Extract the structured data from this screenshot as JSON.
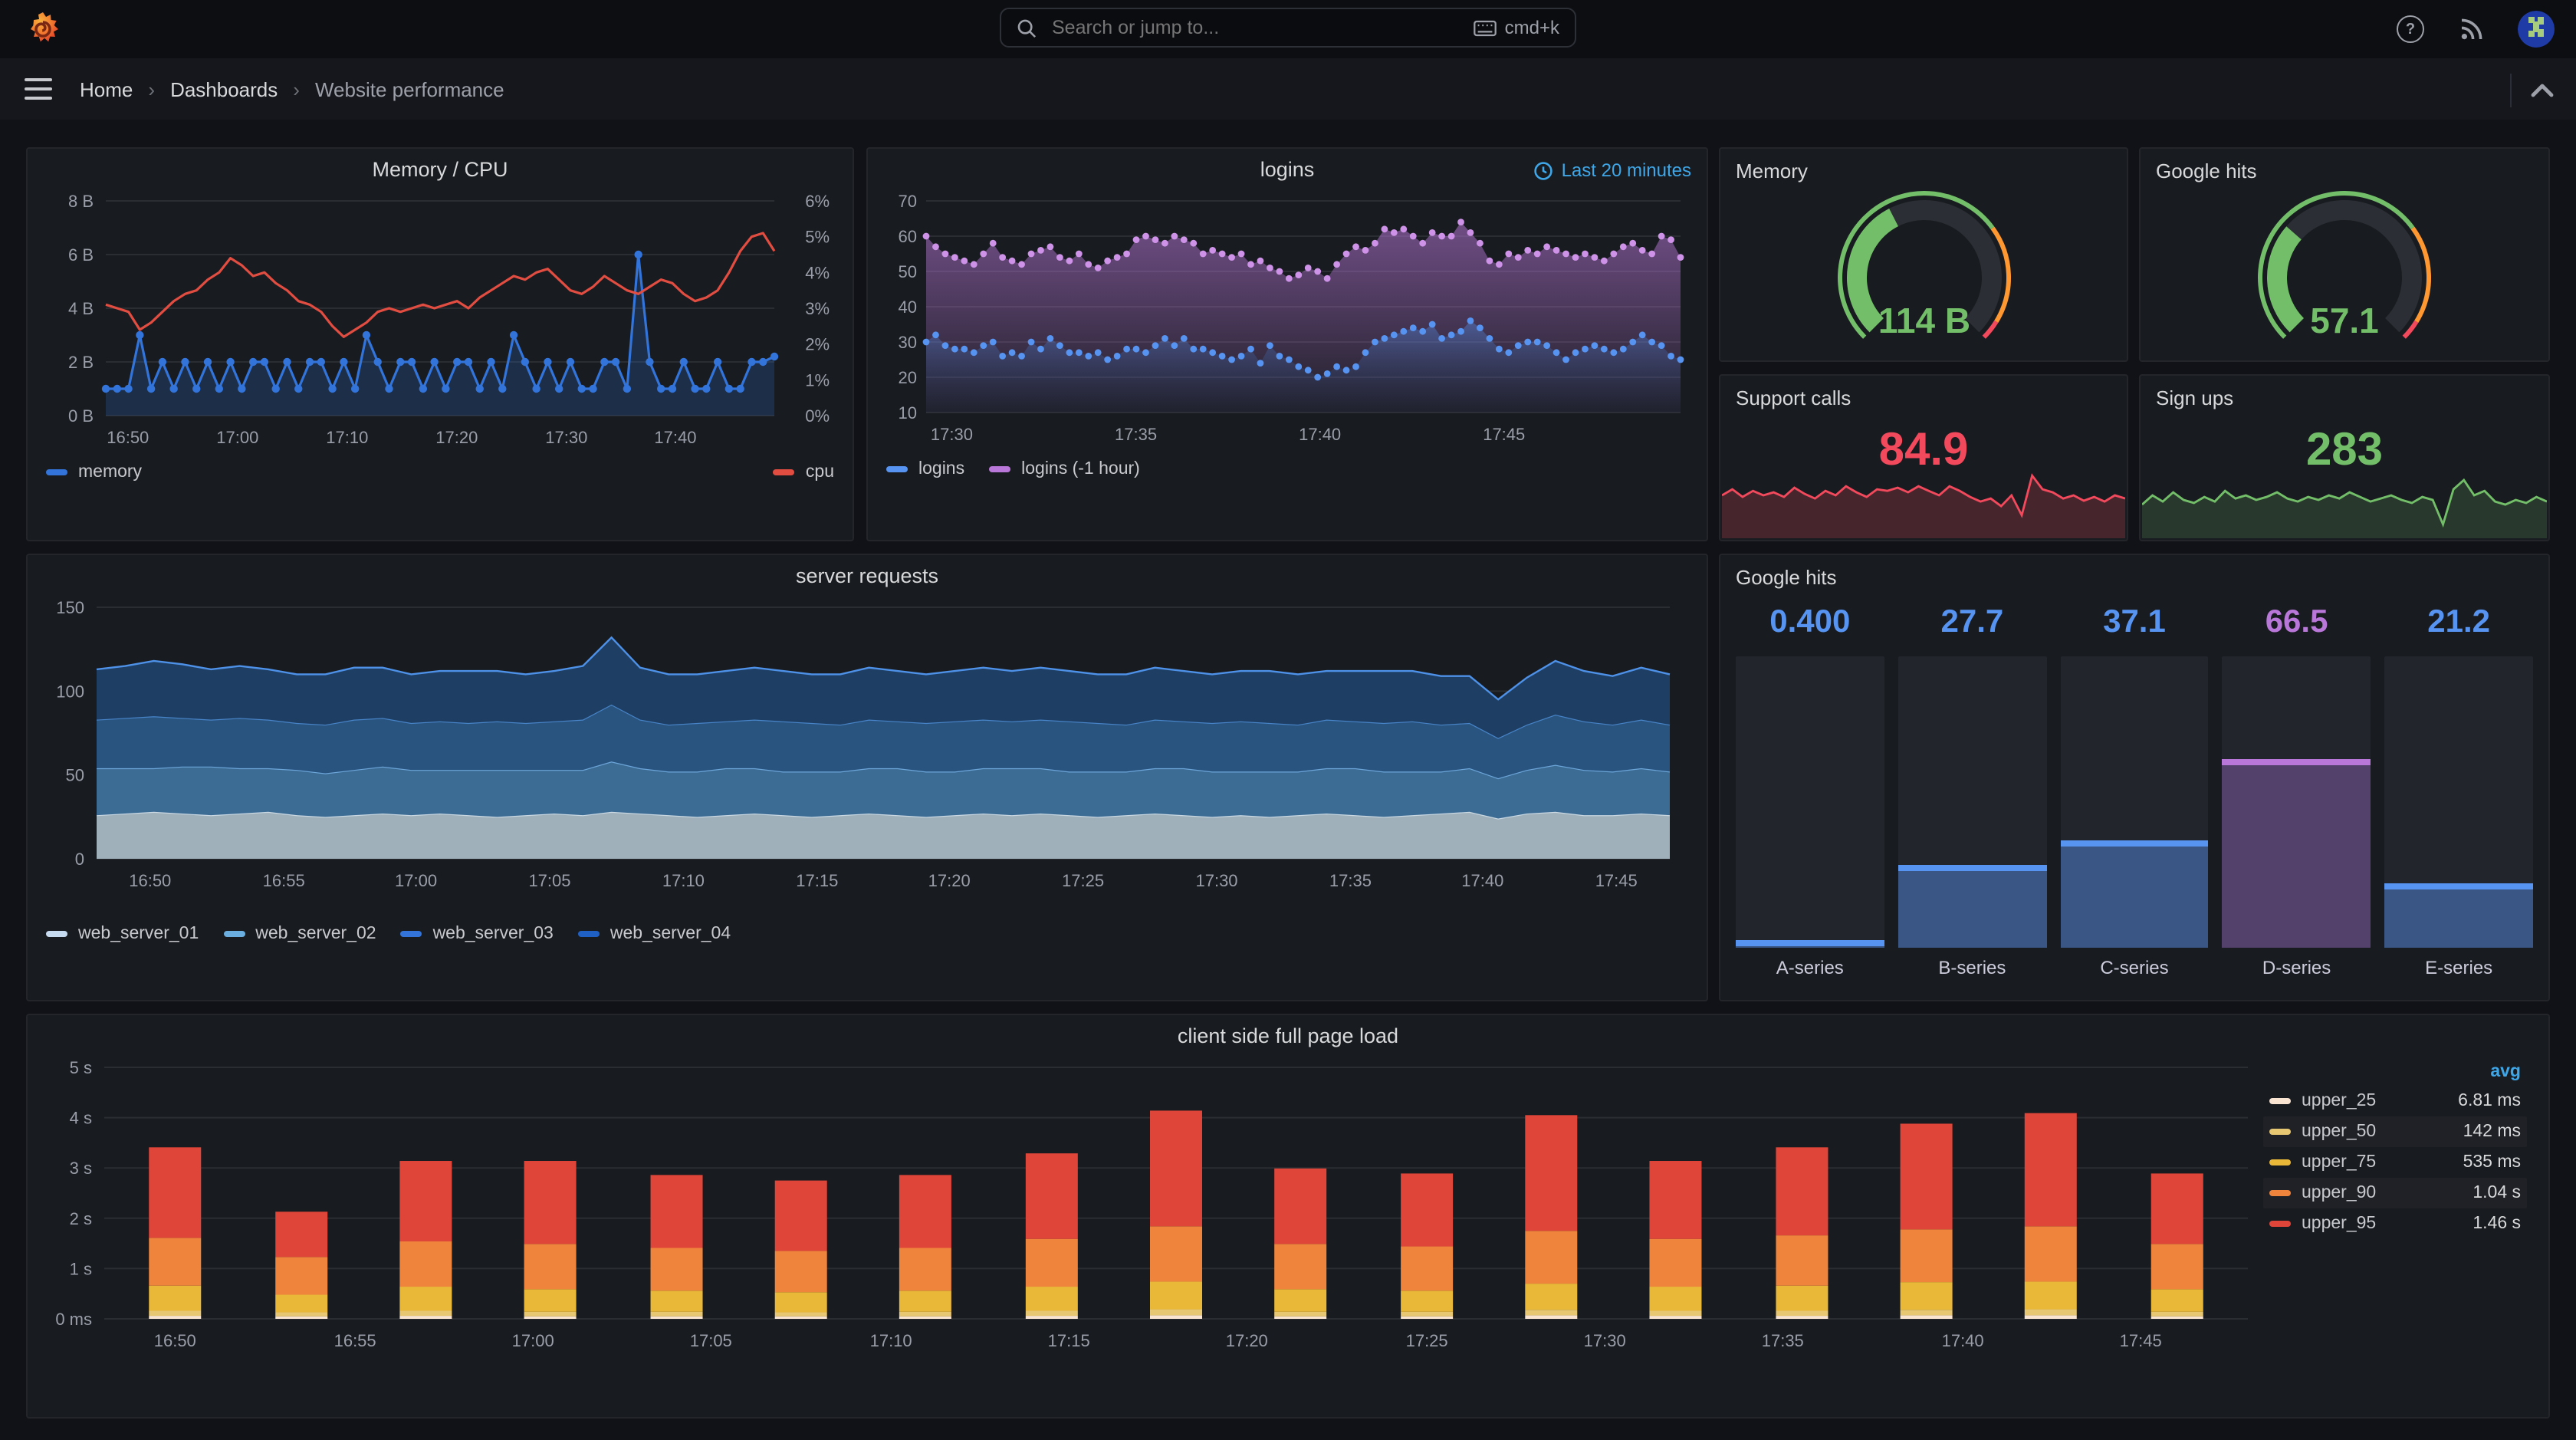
{
  "topnav": {
    "search_placeholder": "Search or jump to...",
    "shortcut": "cmd+k"
  },
  "breadcrumb": {
    "items": [
      "Home",
      "Dashboards",
      "Website performance"
    ],
    "separator": "›"
  },
  "colors": {
    "accent_blue": "#3FA7E8",
    "green": "#73BF69",
    "red": "#F2495C",
    "orange": "#FF9830",
    "series_blue": "#5794F2",
    "purple": "#B877D9",
    "panel_bg": "#181B1F",
    "page_bg": "#111217"
  },
  "chart_data": [
    {
      "id": "memcpu",
      "type": "line",
      "title": "Memory / CPU",
      "y_left": {
        "max": 8,
        "ticks": [
          {
            "v": 8,
            "l": "8 B"
          },
          {
            "v": 6,
            "l": "6 B"
          },
          {
            "v": 4,
            "l": "4 B"
          },
          {
            "v": 2,
            "l": "2 B"
          },
          {
            "v": 0,
            "l": "0 B"
          }
        ]
      },
      "y_right": {
        "max": 6,
        "ticks": [
          {
            "v": 6,
            "l": "6%"
          },
          {
            "v": 5,
            "l": "5%"
          },
          {
            "v": 4,
            "l": "4%"
          },
          {
            "v": 3,
            "l": "3%"
          },
          {
            "v": 2,
            "l": "2%"
          },
          {
            "v": 1,
            "l": "1%"
          },
          {
            "v": 0,
            "l": "0%"
          }
        ]
      },
      "x_ticks": [
        {
          "f": 0.033,
          "l": "16:50"
        },
        {
          "f": 0.197,
          "l": "17:00"
        },
        {
          "f": 0.361,
          "l": "17:10"
        },
        {
          "f": 0.525,
          "l": "17:20"
        },
        {
          "f": 0.689,
          "l": "17:30"
        },
        {
          "f": 0.852,
          "l": "17:40"
        }
      ],
      "series": [
        {
          "name": "memory",
          "color": "#3274D9",
          "unit": "B",
          "axis": "left",
          "values": [
            1,
            1,
            1,
            3,
            1,
            2,
            1,
            2,
            1,
            2,
            1,
            2,
            1,
            2,
            2,
            1,
            2,
            1,
            2,
            2,
            1,
            2,
            1,
            3,
            2,
            1,
            2,
            2,
            1,
            2,
            1,
            2,
            2,
            1,
            2,
            1,
            3,
            2,
            1,
            2,
            1,
            2,
            1,
            1,
            2,
            2,
            1,
            6,
            2,
            1,
            1,
            2,
            1,
            1,
            2,
            1,
            1,
            2,
            2,
            2.2
          ]
        },
        {
          "name": "cpu",
          "color": "#E24D42",
          "unit": "%",
          "axis": "right",
          "values": [
            3.1,
            3,
            2.9,
            2.4,
            2.6,
            2.9,
            3.2,
            3.4,
            3.5,
            3.8,
            4,
            4.4,
            4.2,
            3.9,
            4,
            3.7,
            3.5,
            3.2,
            3.1,
            2.9,
            2.5,
            2.2,
            2.4,
            2.6,
            2.9,
            3,
            2.9,
            3,
            3.1,
            3,
            3.1,
            3.2,
            3,
            3.3,
            3.5,
            3.7,
            3.9,
            3.8,
            4,
            4.1,
            3.8,
            3.5,
            3.4,
            3.6,
            3.9,
            3.7,
            3.5,
            3.4,
            3.6,
            3.8,
            3.7,
            3.4,
            3.2,
            3.3,
            3.5,
            4,
            4.6,
            5,
            5.1,
            4.6
          ]
        }
      ]
    },
    {
      "id": "logins",
      "type": "scatter",
      "title": "logins",
      "time_badge": "Last 20 minutes",
      "y": {
        "min": 10,
        "max": 70,
        "ticks": [
          70,
          60,
          50,
          40,
          30,
          20,
          10
        ]
      },
      "x_ticks": [
        {
          "f": 0.034,
          "l": "17:30"
        },
        {
          "f": 0.278,
          "l": "17:35"
        },
        {
          "f": 0.522,
          "l": "17:40"
        },
        {
          "f": 0.766,
          "l": "17:45"
        }
      ],
      "series": [
        {
          "name": "logins",
          "color": "#5794F2",
          "dot": "#5794F2",
          "values": [
            30,
            32,
            29,
            28,
            28,
            27,
            29,
            30,
            26,
            27,
            26,
            30,
            28,
            31,
            29,
            27,
            27,
            26,
            27,
            25,
            26,
            28,
            28,
            27,
            29,
            31,
            29,
            31,
            28,
            28,
            27,
            26,
            25,
            26,
            28,
            24,
            29,
            26,
            25,
            23,
            22,
            20,
            21,
            23,
            22,
            23,
            27,
            30,
            31,
            32,
            33,
            34,
            33,
            35,
            31,
            32,
            33,
            36,
            34,
            31,
            28,
            27,
            29,
            30,
            30,
            29,
            27,
            25,
            27,
            28,
            29,
            28,
            27,
            28,
            30,
            32,
            30,
            29,
            26,
            25
          ]
        },
        {
          "name": "logins (-1 hour)",
          "color": "#B877D9",
          "dot": "#CE93E8",
          "values": [
            60,
            57,
            55,
            54,
            53,
            52,
            55,
            58,
            54,
            53,
            52,
            55,
            56,
            57,
            54,
            53,
            55,
            52,
            51,
            53,
            54,
            55,
            59,
            60,
            59,
            58,
            60,
            59,
            58,
            55,
            56,
            55,
            54,
            55,
            52,
            53,
            51,
            50,
            48,
            49,
            51,
            50,
            48,
            52,
            55,
            57,
            56,
            58,
            62,
            61,
            62,
            60,
            58,
            61,
            60,
            60,
            64,
            61,
            58,
            53,
            52,
            55,
            54,
            56,
            55,
            57,
            56,
            55,
            54,
            55,
            54,
            53,
            55,
            57,
            58,
            56,
            55,
            60,
            59,
            54
          ]
        }
      ]
    },
    {
      "id": "server",
      "type": "area-stacked",
      "title": "server requests",
      "y": {
        "min": 0,
        "max": 150,
        "ticks": [
          150,
          100,
          50,
          0
        ]
      },
      "x_ticks": [
        {
          "f": 0.034,
          "l": "16:50"
        },
        {
          "f": 0.119,
          "l": "16:55"
        },
        {
          "f": 0.203,
          "l": "17:00"
        },
        {
          "f": 0.288,
          "l": "17:05"
        },
        {
          "f": 0.373,
          "l": "17:10"
        },
        {
          "f": 0.458,
          "l": "17:15"
        },
        {
          "f": 0.542,
          "l": "17:20"
        },
        {
          "f": 0.627,
          "l": "17:25"
        },
        {
          "f": 0.712,
          "l": "17:30"
        },
        {
          "f": 0.797,
          "l": "17:35"
        },
        {
          "f": 0.881,
          "l": "17:40"
        },
        {
          "f": 0.966,
          "l": "17:45"
        }
      ],
      "series": [
        {
          "name": "web_server_01",
          "fill": "#9FB0BA",
          "edge": "#C9D8E2",
          "swatch": "#C7DBF0",
          "values": [
            26,
            27,
            28,
            27,
            26,
            27,
            28,
            26,
            25,
            26,
            27,
            26,
            27,
            26,
            25,
            26,
            27,
            26,
            28,
            27,
            26,
            25,
            26,
            27,
            26,
            25,
            26,
            27,
            26,
            25,
            26,
            27,
            26,
            27,
            26,
            25,
            26,
            27,
            26,
            25,
            26,
            25,
            26,
            27,
            26,
            25,
            26,
            27,
            28,
            24,
            27,
            28,
            26,
            26,
            27,
            26
          ]
        },
        {
          "name": "web_server_02",
          "fill": "#3C6B94",
          "edge": "#6CA6D9",
          "swatch": "#6BAEE0",
          "values": [
            28,
            27,
            26,
            28,
            29,
            27,
            26,
            27,
            26,
            27,
            28,
            27,
            26,
            27,
            28,
            27,
            26,
            27,
            30,
            27,
            26,
            27,
            28,
            27,
            26,
            27,
            26,
            27,
            28,
            27,
            26,
            27,
            28,
            27,
            26,
            27,
            26,
            27,
            28,
            27,
            26,
            27,
            26,
            27,
            28,
            27,
            26,
            25,
            26,
            24,
            26,
            28,
            27,
            26,
            27,
            26
          ]
        },
        {
          "name": "web_server_03",
          "fill": "#2A5480",
          "edge": "#4784C8",
          "swatch": "#3274D9",
          "values": [
            29,
            30,
            31,
            29,
            28,
            30,
            29,
            28,
            29,
            30,
            29,
            28,
            29,
            28,
            29,
            28,
            29,
            30,
            34,
            29,
            28,
            29,
            28,
            29,
            30,
            29,
            28,
            29,
            28,
            29,
            30,
            29,
            28,
            29,
            30,
            29,
            28,
            29,
            28,
            29,
            30,
            29,
            28,
            29,
            28,
            29,
            30,
            28,
            27,
            24,
            27,
            30,
            29,
            28,
            29,
            28
          ]
        },
        {
          "name": "web_server_04",
          "fill": "#1E3F63",
          "edge": "#4E91E8",
          "swatch": "#1F60C4",
          "values": [
            30,
            31,
            33,
            32,
            30,
            31,
            30,
            29,
            30,
            31,
            30,
            29,
            30,
            31,
            30,
            29,
            30,
            32,
            40,
            31,
            30,
            29,
            30,
            31,
            30,
            29,
            30,
            31,
            30,
            29,
            30,
            31,
            30,
            31,
            30,
            29,
            30,
            31,
            30,
            29,
            30,
            31,
            30,
            29,
            30,
            31,
            30,
            29,
            28,
            23,
            28,
            32,
            30,
            29,
            31,
            30
          ]
        }
      ]
    },
    {
      "id": "gauge_memory",
      "type": "gauge",
      "title": "Memory",
      "display": "114 B",
      "fraction": 0.4,
      "thresholds": [
        {
          "to": 0.7,
          "color": "#73BF69"
        },
        {
          "to": 0.95,
          "color": "#FF9830"
        },
        {
          "to": 1,
          "color": "#F2495C"
        }
      ]
    },
    {
      "id": "gauge_google",
      "type": "gauge",
      "title": "Google hits",
      "display": "57.1",
      "fraction": 0.32,
      "thresholds": [
        {
          "to": 0.7,
          "color": "#73BF69"
        },
        {
          "to": 0.95,
          "color": "#FF9830"
        },
        {
          "to": 1,
          "color": "#F2495C"
        }
      ]
    },
    {
      "id": "stat_support",
      "type": "stat-sparkline",
      "title": "Support calls",
      "display": "84.9",
      "color": "#F2495C",
      "values": [
        52,
        60,
        50,
        58,
        52,
        56,
        50,
        62,
        54,
        48,
        58,
        52,
        64,
        56,
        50,
        60,
        58,
        62,
        56,
        64,
        58,
        52,
        64,
        58,
        50,
        44,
        48,
        38,
        52,
        26,
        78,
        60,
        56,
        48,
        52,
        45,
        50,
        44,
        52,
        48
      ]
    },
    {
      "id": "stat_signups",
      "type": "stat-sparkline",
      "title": "Sign ups",
      "display": "283",
      "color": "#73BF69",
      "values": [
        40,
        52,
        44,
        56,
        46,
        42,
        50,
        44,
        58,
        48,
        52,
        46,
        50,
        56,
        48,
        44,
        50,
        46,
        52,
        48,
        56,
        50,
        44,
        48,
        52,
        46,
        42,
        50,
        46,
        14,
        60,
        72,
        52,
        58,
        44,
        40,
        46,
        42,
        50,
        44
      ]
    },
    {
      "id": "google_bars",
      "type": "bargauge",
      "title": "Google hits",
      "max": 100,
      "categories": [
        "A-series",
        "B-series",
        "C-series",
        "D-series",
        "E-series"
      ],
      "display": [
        "0.400",
        "27.7",
        "37.1",
        "66.5",
        "21.2"
      ],
      "values": [
        0.4,
        27.7,
        37.1,
        66.5,
        21.2
      ],
      "value_colors": [
        "#5794F2",
        "#5794F2",
        "#5794F2",
        "#B877D9",
        "#5794F2"
      ],
      "fill_colors": [
        "#3A5684",
        "#3A5684",
        "#3A5684",
        "#53406B",
        "#3A5684"
      ],
      "edge_colors": [
        "#5794F2",
        "#5794F2",
        "#5794F2",
        "#B877D9",
        "#5794F2"
      ]
    },
    {
      "id": "client",
      "type": "bar-stacked",
      "title": "client side full page load",
      "legend_header": "avg",
      "y_ticks": [
        {
          "v": 5,
          "l": "5 s"
        },
        {
          "v": 4,
          "l": "4 s"
        },
        {
          "v": 3,
          "l": "3 s"
        },
        {
          "v": 2,
          "l": "2 s"
        },
        {
          "v": 1,
          "l": "1 s"
        },
        {
          "v": 0,
          "l": "0 ms"
        }
      ],
      "x_ticks": [
        {
          "f": 0.033,
          "l": "16:50"
        },
        {
          "f": 0.117,
          "l": "16:55"
        },
        {
          "f": 0.2,
          "l": "17:00"
        },
        {
          "f": 0.283,
          "l": "17:05"
        },
        {
          "f": 0.367,
          "l": "17:10"
        },
        {
          "f": 0.45,
          "l": "17:15"
        },
        {
          "f": 0.533,
          "l": "17:20"
        },
        {
          "f": 0.617,
          "l": "17:25"
        },
        {
          "f": 0.7,
          "l": "17:30"
        },
        {
          "f": 0.783,
          "l": "17:35"
        },
        {
          "f": 0.867,
          "l": "17:40"
        },
        {
          "f": 0.95,
          "l": "17:45"
        }
      ],
      "bar_fracs": [
        0.033,
        0.092,
        0.15,
        0.208,
        0.267,
        0.325,
        0.383,
        0.442,
        0.5,
        0.558,
        0.617,
        0.675,
        0.733,
        0.792,
        0.85,
        0.908,
        0.967
      ],
      "series": [
        {
          "name": "upper_25",
          "color": "#F9E3D1",
          "avg": "6.81 ms",
          "values": [
            0.06,
            0.05,
            0.06,
            0.05,
            0.05,
            0.05,
            0.05,
            0.06,
            0.07,
            0.05,
            0.05,
            0.07,
            0.06,
            0.06,
            0.07,
            0.07,
            0.05
          ]
        },
        {
          "name": "upper_50",
          "color": "#E8C772",
          "avg": "142 ms",
          "values": [
            0.1,
            0.08,
            0.1,
            0.09,
            0.09,
            0.08,
            0.09,
            0.1,
            0.12,
            0.09,
            0.09,
            0.11,
            0.1,
            0.1,
            0.11,
            0.12,
            0.09
          ]
        },
        {
          "name": "upper_75",
          "color": "#EAB839",
          "avg": "535 ms",
          "values": [
            0.5,
            0.35,
            0.48,
            0.45,
            0.42,
            0.4,
            0.42,
            0.48,
            0.55,
            0.45,
            0.42,
            0.52,
            0.48,
            0.5,
            0.55,
            0.55,
            0.45
          ]
        },
        {
          "name": "upper_90",
          "color": "#EF843C",
          "avg": "1.04 s",
          "values": [
            0.95,
            0.75,
            0.9,
            0.9,
            0.85,
            0.82,
            0.85,
            0.95,
            1.1,
            0.9,
            0.88,
            1.05,
            0.95,
            1.0,
            1.05,
            1.1,
            0.9
          ]
        },
        {
          "name": "upper_95",
          "color": "#E0453A",
          "avg": "1.46 s",
          "values": [
            1.8,
            0.9,
            1.6,
            1.65,
            1.45,
            1.4,
            1.45,
            1.7,
            2.3,
            1.5,
            1.45,
            2.3,
            1.55,
            1.75,
            2.1,
            2.25,
            1.4
          ]
        }
      ]
    }
  ]
}
